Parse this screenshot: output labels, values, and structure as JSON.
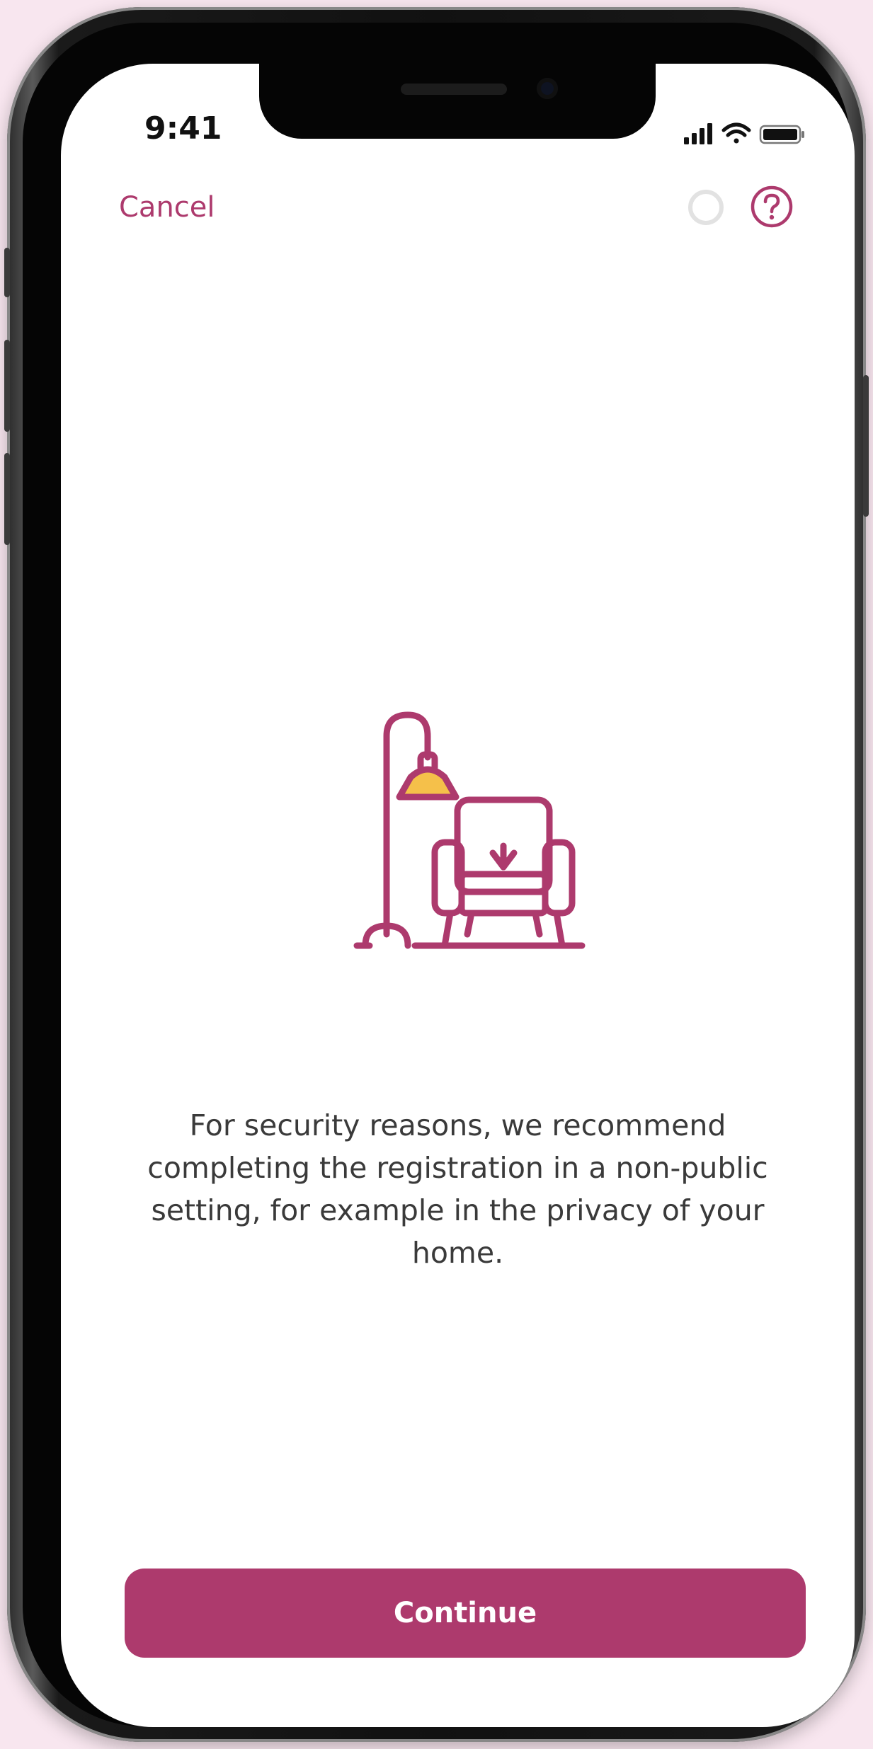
{
  "status_bar": {
    "time": "9:41"
  },
  "header": {
    "cancel_label": "Cancel"
  },
  "illustration": {
    "icon": "armchair-with-floor-lamp-icon",
    "accent_color": "#ad3a6d",
    "lamp_shade_color": "#f5c04a"
  },
  "main": {
    "message": "For security reasons, we recommend completing the registration in a non-public setting, for example in the privacy of your home."
  },
  "footer": {
    "continue_label": "Continue"
  },
  "colors": {
    "brand": "#ad3a6d",
    "background": "#ffffff",
    "page_background": "#f8e6ef"
  }
}
